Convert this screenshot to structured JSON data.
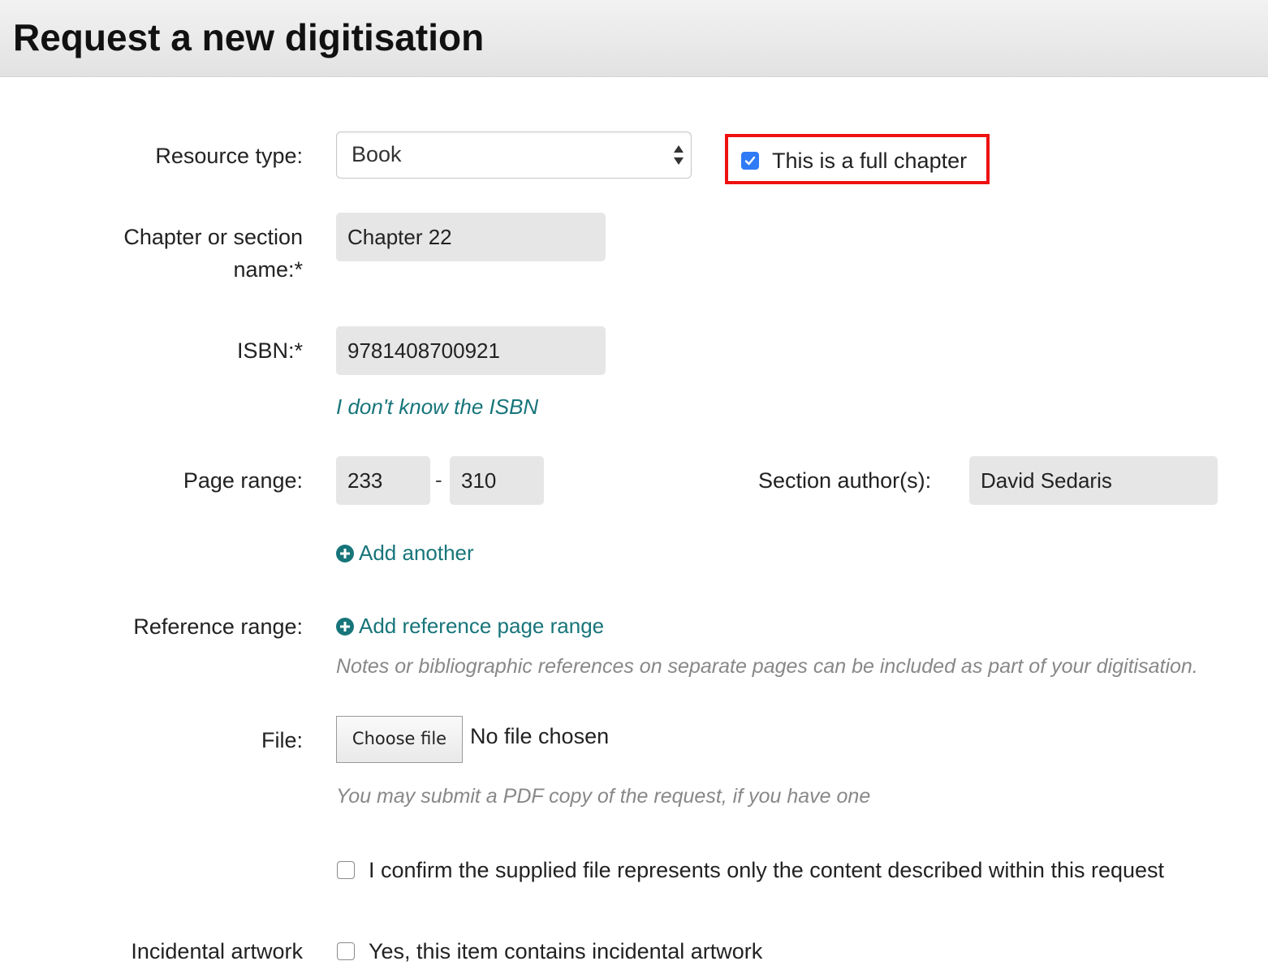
{
  "page": {
    "title": "Request a new digitisation"
  },
  "form": {
    "resource_type": {
      "label": "Resource type:",
      "value": "Book"
    },
    "full_chapter": {
      "label": "This is a full chapter",
      "checked": true
    },
    "chapter_name": {
      "label_line1": "Chapter or section",
      "label_line2": "name:*",
      "value": "Chapter 22"
    },
    "isbn": {
      "label": "ISBN:*",
      "value": "9781408700921",
      "unknown_link": "I don't know the ISBN"
    },
    "page_range": {
      "label": "Page range:",
      "from": "233",
      "separator": "-",
      "to": "310",
      "add_another": "Add another"
    },
    "section_author": {
      "label": "Section author(s):",
      "value": "David Sedaris"
    },
    "reference_range": {
      "label": "Reference range:",
      "add_link": "Add reference page range",
      "help": "Notes or bibliographic references on separate pages can be included as part of your digitisation."
    },
    "file": {
      "label": "File:",
      "button": "Choose file",
      "status": "No file chosen",
      "help": "You may submit a PDF copy of the request, if you have one"
    },
    "confirm": {
      "label": "I confirm the supplied file represents only the content described within this request",
      "checked": false
    },
    "incidental_artwork": {
      "label": "Incidental artwork",
      "checkbox_label": "Yes, this item contains incidental artwork",
      "checked": false
    }
  },
  "colors": {
    "link": "#17757a",
    "highlight": "#ee1111",
    "checkbox_checked": "#2f7bf6"
  }
}
